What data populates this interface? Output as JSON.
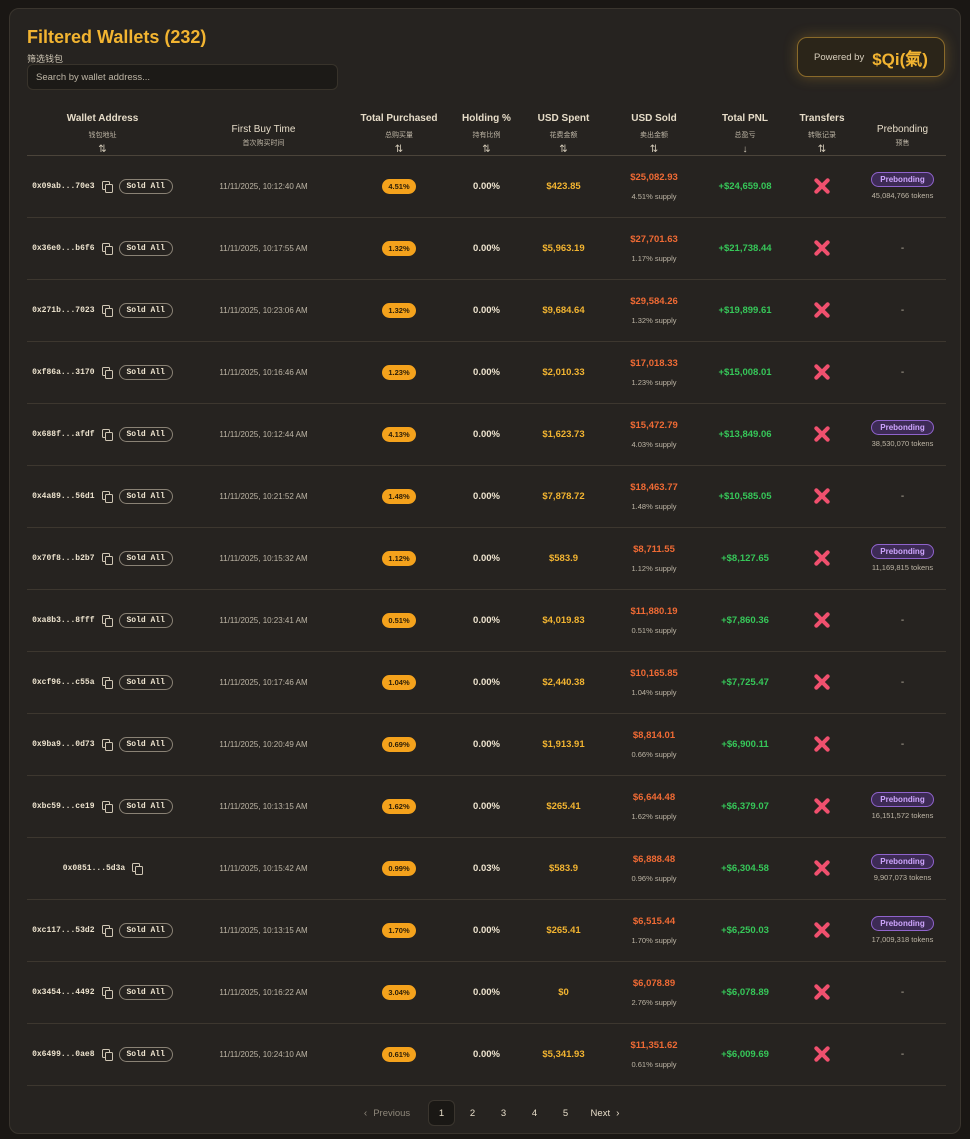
{
  "header": {
    "title": "Filtered Wallets (232)",
    "subtitle": "筛选钱包",
    "search_placeholder": "Search by wallet address...",
    "powered_by": "Powered by",
    "brand": "$Qi(氣)"
  },
  "columns": [
    {
      "title": "Wallet Address",
      "sub": "钱包地址",
      "sort": "⇅"
    },
    {
      "title": "First Buy Time",
      "sub": "首次购买时间",
      "sort": ""
    },
    {
      "title": "Total Purchased",
      "sub": "总购买量",
      "sort": "⇅"
    },
    {
      "title": "Holding %",
      "sub": "持有比例",
      "sort": "⇅"
    },
    {
      "title": "USD Spent",
      "sub": "花费金额",
      "sort": "⇅"
    },
    {
      "title": "USD Sold",
      "sub": "卖出金额",
      "sort": "⇅"
    },
    {
      "title": "Total PNL",
      "sub": "总盈亏",
      "sort": "↓"
    },
    {
      "title": "Transfers",
      "sub": "转账记录",
      "sort": "⇅"
    },
    {
      "title": "Prebonding",
      "sub": "预售",
      "sort": ""
    }
  ],
  "sold_all_label": "Sold All",
  "prebonding_label": "Prebonding",
  "rows": [
    {
      "address": "0x09ab...70e3",
      "sold_all": true,
      "first_buy": "11/11/2025, 10:12:40 AM",
      "purchased": "4.51%",
      "holding": "0.00%",
      "spent": "$423.85",
      "sold_usd": "$25,082.93",
      "sold_supply": "4.51% supply",
      "pnl": "+$24,659.08",
      "transfers_icon": "x-icon",
      "prebonding": "45,084,766 tokens"
    },
    {
      "address": "0x36e0...b6f6",
      "sold_all": true,
      "first_buy": "11/11/2025, 10:17:55 AM",
      "purchased": "1.32%",
      "holding": "0.00%",
      "spent": "$5,963.19",
      "sold_usd": "$27,701.63",
      "sold_supply": "1.17% supply",
      "pnl": "+$21,738.44",
      "transfers_icon": "x-icon",
      "prebonding": null
    },
    {
      "address": "0x271b...7023",
      "sold_all": true,
      "first_buy": "11/11/2025, 10:23:06 AM",
      "purchased": "1.32%",
      "holding": "0.00%",
      "spent": "$9,684.64",
      "sold_usd": "$29,584.26",
      "sold_supply": "1.32% supply",
      "pnl": "+$19,899.61",
      "transfers_icon": "x-icon",
      "prebonding": null
    },
    {
      "address": "0xf86a...3170",
      "sold_all": true,
      "first_buy": "11/11/2025, 10:16:46 AM",
      "purchased": "1.23%",
      "holding": "0.00%",
      "spent": "$2,010.33",
      "sold_usd": "$17,018.33",
      "sold_supply": "1.23% supply",
      "pnl": "+$15,008.01",
      "transfers_icon": "x-icon",
      "prebonding": null
    },
    {
      "address": "0x688f...afdf",
      "sold_all": true,
      "first_buy": "11/11/2025, 10:12:44 AM",
      "purchased": "4.13%",
      "holding": "0.00%",
      "spent": "$1,623.73",
      "sold_usd": "$15,472.79",
      "sold_supply": "4.03% supply",
      "pnl": "+$13,849.06",
      "transfers_icon": "x-icon",
      "prebonding": "38,530,070 tokens"
    },
    {
      "address": "0x4a89...56d1",
      "sold_all": true,
      "first_buy": "11/11/2025, 10:21:52 AM",
      "purchased": "1.48%",
      "holding": "0.00%",
      "spent": "$7,878.72",
      "sold_usd": "$18,463.77",
      "sold_supply": "1.48% supply",
      "pnl": "+$10,585.05",
      "transfers_icon": "x-icon",
      "prebonding": null
    },
    {
      "address": "0x70f8...b2b7",
      "sold_all": true,
      "first_buy": "11/11/2025, 10:15:32 AM",
      "purchased": "1.12%",
      "holding": "0.00%",
      "spent": "$583.9",
      "sold_usd": "$8,711.55",
      "sold_supply": "1.12% supply",
      "pnl": "+$8,127.65",
      "transfers_icon": "x-icon",
      "prebonding": "11,169,815 tokens"
    },
    {
      "address": "0xa8b3...8fff",
      "sold_all": true,
      "first_buy": "11/11/2025, 10:23:41 AM",
      "purchased": "0.51%",
      "holding": "0.00%",
      "spent": "$4,019.83",
      "sold_usd": "$11,880.19",
      "sold_supply": "0.51% supply",
      "pnl": "+$7,860.36",
      "transfers_icon": "x-icon",
      "prebonding": null
    },
    {
      "address": "0xcf96...c55a",
      "sold_all": true,
      "first_buy": "11/11/2025, 10:17:46 AM",
      "purchased": "1.04%",
      "holding": "0.00%",
      "spent": "$2,440.38",
      "sold_usd": "$10,165.85",
      "sold_supply": "1.04% supply",
      "pnl": "+$7,725.47",
      "transfers_icon": "x-icon",
      "prebonding": null
    },
    {
      "address": "0x9ba9...0d73",
      "sold_all": true,
      "first_buy": "11/11/2025, 10:20:49 AM",
      "purchased": "0.69%",
      "holding": "0.00%",
      "spent": "$1,913.91",
      "sold_usd": "$8,814.01",
      "sold_supply": "0.66% supply",
      "pnl": "+$6,900.11",
      "transfers_icon": "x-icon",
      "prebonding": null
    },
    {
      "address": "0xbc59...ce19",
      "sold_all": true,
      "first_buy": "11/11/2025, 10:13:15 AM",
      "purchased": "1.62%",
      "holding": "0.00%",
      "spent": "$265.41",
      "sold_usd": "$6,644.48",
      "sold_supply": "1.62% supply",
      "pnl": "+$6,379.07",
      "transfers_icon": "x-icon",
      "prebonding": "16,151,572 tokens"
    },
    {
      "address": "0x0851...5d3a",
      "sold_all": false,
      "first_buy": "11/11/2025, 10:15:42 AM",
      "purchased": "0.99%",
      "holding": "0.03%",
      "spent": "$583.9",
      "sold_usd": "$6,888.48",
      "sold_supply": "0.96% supply",
      "pnl": "+$6,304.58",
      "transfers_icon": "x-icon",
      "prebonding": "9,907,073 tokens"
    },
    {
      "address": "0xc117...53d2",
      "sold_all": true,
      "first_buy": "11/11/2025, 10:13:15 AM",
      "purchased": "1.70%",
      "holding": "0.00%",
      "spent": "$265.41",
      "sold_usd": "$6,515.44",
      "sold_supply": "1.70% supply",
      "pnl": "+$6,250.03",
      "transfers_icon": "x-icon",
      "prebonding": "17,009,318 tokens"
    },
    {
      "address": "0x3454...4492",
      "sold_all": true,
      "first_buy": "11/11/2025, 10:16:22 AM",
      "purchased": "3.04%",
      "holding": "0.00%",
      "spent": "$0",
      "sold_usd": "$6,078.89",
      "sold_supply": "2.76% supply",
      "pnl": "+$6,078.89",
      "transfers_icon": "x-icon",
      "prebonding": null
    },
    {
      "address": "0x6499...0ae8",
      "sold_all": true,
      "first_buy": "11/11/2025, 10:24:10 AM",
      "purchased": "0.61%",
      "holding": "0.00%",
      "spent": "$5,341.93",
      "sold_usd": "$11,351.62",
      "sold_supply": "0.61% supply",
      "pnl": "+$6,009.69",
      "transfers_icon": "x-icon",
      "prebonding": null
    }
  ],
  "empty_value": "-",
  "pagination": {
    "previous": "Previous",
    "next": "Next",
    "pages": [
      "1",
      "2",
      "3",
      "4",
      "5"
    ],
    "current": "1"
  }
}
